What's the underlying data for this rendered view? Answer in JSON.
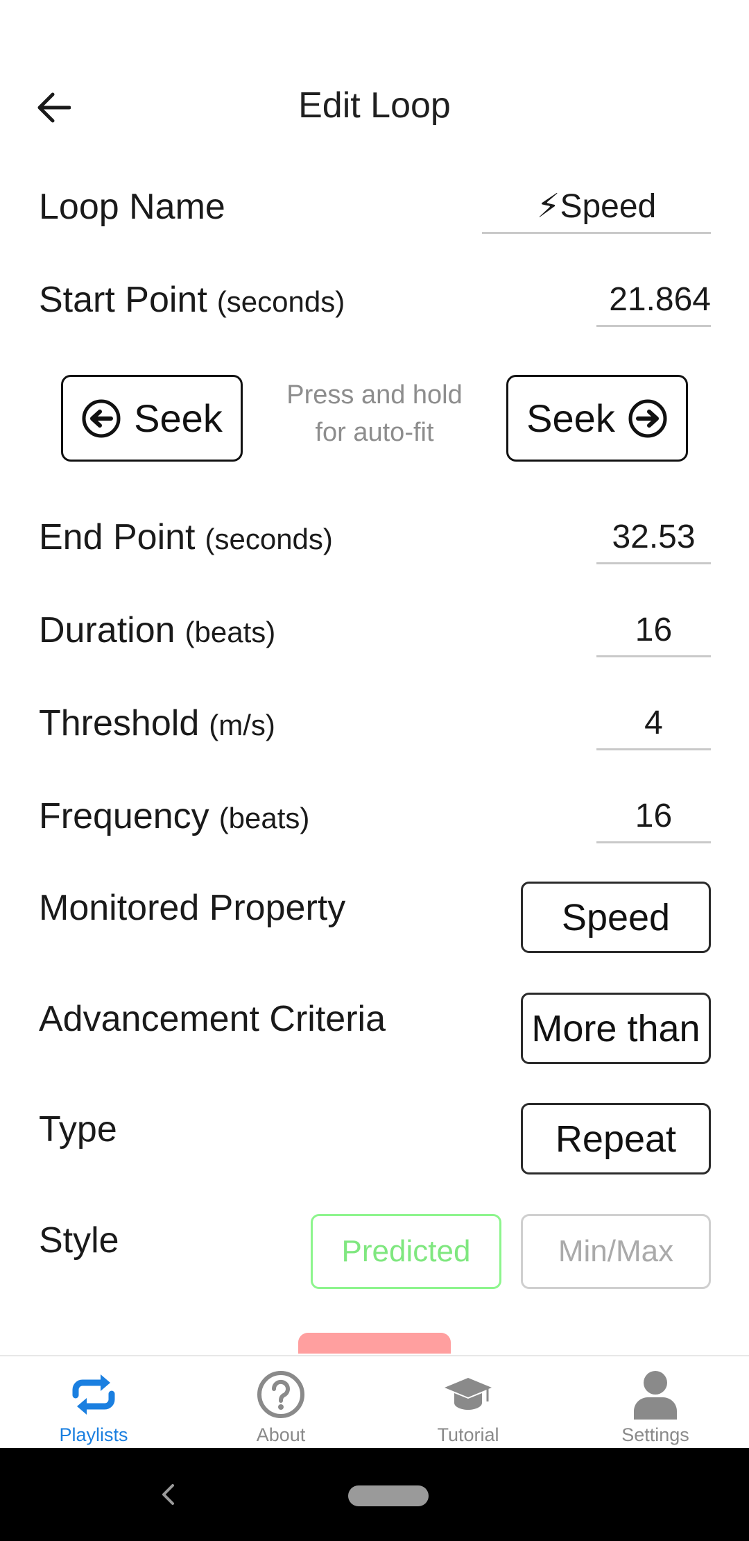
{
  "header": {
    "title": "Edit Loop",
    "back_icon": "arrow-left-icon"
  },
  "loop_name": {
    "label": "Loop Name",
    "value": "⚡Speed"
  },
  "start_point": {
    "label": "Start Point",
    "unit": "(seconds)",
    "value": "21.864"
  },
  "seek": {
    "back_label": "Seek",
    "forward_label": "Seek",
    "hint_line1": "Press and hold",
    "hint_line2": "for auto-fit"
  },
  "end_point": {
    "label": "End Point",
    "unit": "(seconds)",
    "value": "32.53"
  },
  "duration": {
    "label": "Duration",
    "unit": "(beats)",
    "value": "16"
  },
  "threshold": {
    "label": "Threshold",
    "unit": "(m/s)",
    "value": "4"
  },
  "frequency": {
    "label": "Frequency",
    "unit": "(beats)",
    "value": "16"
  },
  "monitored_property": {
    "label": "Monitored Property",
    "value": "Speed"
  },
  "advancement_criteria": {
    "label": "Advancement Criteria",
    "value": "More than"
  },
  "type": {
    "label": "Type",
    "value": "Repeat"
  },
  "style": {
    "label": "Style",
    "option_selected": "Predicted",
    "option_other": "Min/Max"
  },
  "bottom_nav": {
    "items": [
      {
        "label": "Playlists",
        "icon": "repeat-icon",
        "active": true
      },
      {
        "label": "About",
        "icon": "question-circle-icon",
        "active": false
      },
      {
        "label": "Tutorial",
        "icon": "graduation-cap-icon",
        "active": false
      },
      {
        "label": "Settings",
        "icon": "user-icon",
        "active": false
      }
    ]
  },
  "colors": {
    "accent": "#1a7fe0",
    "inactive_nav": "#8a8a8a",
    "predicted_green": "#7fe77f",
    "danger_peek": "#ff9f9f"
  }
}
